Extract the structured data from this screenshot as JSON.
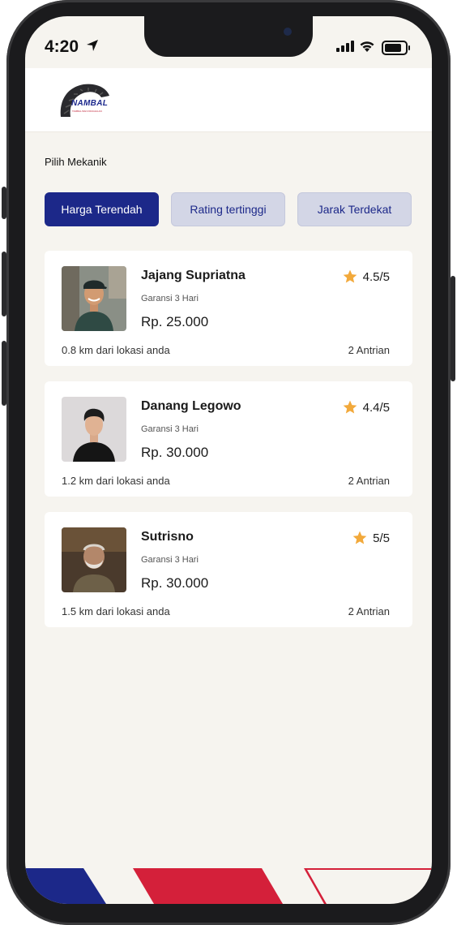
{
  "status_bar": {
    "time": "4:20"
  },
  "brand": {
    "name": "NAMBAL",
    "tagline": "TAMBAL BAN PANGGILAN"
  },
  "page": {
    "title": "Pilih Mekanik"
  },
  "filters": [
    {
      "label": "Harga Terendah",
      "active": true
    },
    {
      "label": "Rating tertinggi",
      "active": false
    },
    {
      "label": "Jarak Terdekat",
      "active": false
    }
  ],
  "mechanics": [
    {
      "name": "Jajang Supriatna",
      "warranty": "Garansi 3 Hari",
      "price": "Rp. 25.000",
      "rating": "4.5/5",
      "distance": "0.8 km dari lokasi anda",
      "queue": "2 Antrian"
    },
    {
      "name": "Danang Legowo",
      "warranty": "Garansi 3 Hari",
      "price": "Rp. 30.000",
      "rating": "4.4/5",
      "distance": "1.2 km dari lokasi anda",
      "queue": "2 Antrian"
    },
    {
      "name": "Sutrisno",
      "warranty": "Garansi 3 Hari",
      "price": "Rp. 30.000",
      "rating": "5/5",
      "distance": "1.5 km dari lokasi anda",
      "queue": "2 Antrian"
    }
  ],
  "colors": {
    "primary": "#1c2889",
    "accent_red": "#d4203a",
    "star": "#f2a93b",
    "background": "#f6f4ef"
  }
}
